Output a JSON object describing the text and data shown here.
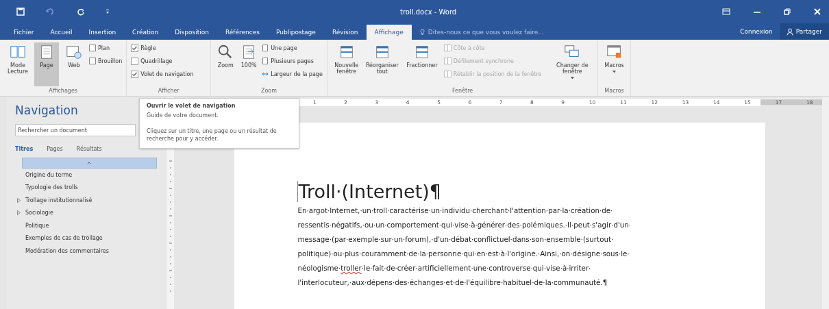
{
  "window": {
    "title": "troll.docx - Word"
  },
  "menu_tabs": [
    {
      "label": "Fichier",
      "selected": false
    },
    {
      "label": "Accueil",
      "selected": false
    },
    {
      "label": "Insertion",
      "selected": false
    },
    {
      "label": "Création",
      "selected": false
    },
    {
      "label": "Disposition",
      "selected": false
    },
    {
      "label": "Références",
      "selected": false
    },
    {
      "label": "Publipostage",
      "selected": false
    },
    {
      "label": "Révision",
      "selected": false
    },
    {
      "label": "Affichage",
      "selected": true
    }
  ],
  "tell_me": {
    "placeholder": "Dites-nous ce que vous voulez faire..."
  },
  "account": {
    "sign_in": "Connexion",
    "share": "Partager"
  },
  "ribbon": {
    "views": {
      "label": "Affichages",
      "large": [
        {
          "label": "Mode Lecture",
          "selected": false
        },
        {
          "label": "Page",
          "selected": true
        },
        {
          "label": "Web",
          "selected": false
        }
      ],
      "small": [
        "Plan",
        "Brouillon"
      ]
    },
    "show": {
      "label": "Afficher",
      "options": [
        {
          "label": "Règle",
          "checked": true
        },
        {
          "label": "Quadrillage",
          "checked": false
        },
        {
          "label": "Volet de navigation",
          "checked": true
        }
      ]
    },
    "zoom": {
      "label": "Zoom",
      "large": [
        "Zoom",
        "100%"
      ],
      "small": [
        "Une page",
        "Plusieurs pages",
        "Largeur de la page"
      ]
    },
    "window": {
      "label": "Fenêtre",
      "large": [
        "Nouvelle fenêtre",
        "Réorganiser tout",
        "Fractionner"
      ],
      "small": [
        {
          "label": "Côte à côte",
          "disabled": true
        },
        {
          "label": "Défilement synchrone",
          "disabled": true
        },
        {
          "label": "Rétablir la position de la fenêtre",
          "disabled": true
        }
      ],
      "switch": "Changer de fenêtre"
    },
    "macros": {
      "label": "Macros",
      "button": "Macros"
    }
  },
  "navigation": {
    "title": "Navigation",
    "search": {
      "placeholder": "Rechercher un document"
    },
    "tabs": [
      {
        "label": "Titres",
        "selected": true
      },
      {
        "label": "Pages",
        "selected": false
      },
      {
        "label": "Résultats",
        "selected": false
      }
    ],
    "headings": [
      {
        "label": "Origine du terme",
        "expandable": false
      },
      {
        "label": "Typologie des trolls",
        "expandable": false
      },
      {
        "label": "Trollage institutionnalisé",
        "expandable": true
      },
      {
        "label": "Sociologie",
        "expandable": true
      },
      {
        "label": "Politique",
        "expandable": false
      },
      {
        "label": "Exemples de cas de trollage",
        "expandable": false
      },
      {
        "label": "Modération des commentaires",
        "expandable": false
      }
    ]
  },
  "tooltip": {
    "title": "Ouvrir le volet de navigation",
    "lines": [
      "Guide de votre document.",
      "Cliquez sur un titre, une page ou un résultat de recherche pour y accéder."
    ]
  },
  "ruler": {
    "labels": [
      "1",
      "2",
      "3",
      "4",
      "5",
      "6",
      "7",
      "8",
      "9",
      "10",
      "11",
      "12",
      "13",
      "14",
      "15",
      "17",
      "18"
    ]
  },
  "document": {
    "title": "Troll·(Internet)¶",
    "paragraph": [
      [
        {
          "text": "En·argot·Internet,·un·troll·caractérise·un·individu·cherchant·l'attention·par·la·création·de·",
          "misspelled": false
        }
      ],
      [
        {
          "text": "ressentis·négatifs,·ou·un·comportement·qui·vise·à·générer·des·polémiques.·Il·peut·s'agir·d'un·",
          "misspelled": false
        }
      ],
      [
        {
          "text": "message·(par·exemple·sur·un·forum),·d'un·débat·conflictuel·dans·son·ensemble·(surtout·",
          "misspelled": false
        }
      ],
      [
        {
          "text": "politique)·ou·plus·couramment·de·la·personne·qui·en·est·à·l'origine.·Ainsi,·on·désigne·sous·le·",
          "misspelled": false
        }
      ],
      [
        {
          "text": "néologisme·",
          "misspelled": false
        },
        {
          "text": "troller",
          "misspelled": true
        },
        {
          "text": "·le·fait·de·créer·artificiellement·une·controverse·qui·vise·à·irriter·",
          "misspelled": false
        }
      ],
      [
        {
          "text": "l'interlocuteur,·aux·dépens·des·échanges·et·de·l'équilibre·habituel·de·la·communauté.¶",
          "misspelled": false
        }
      ]
    ]
  }
}
